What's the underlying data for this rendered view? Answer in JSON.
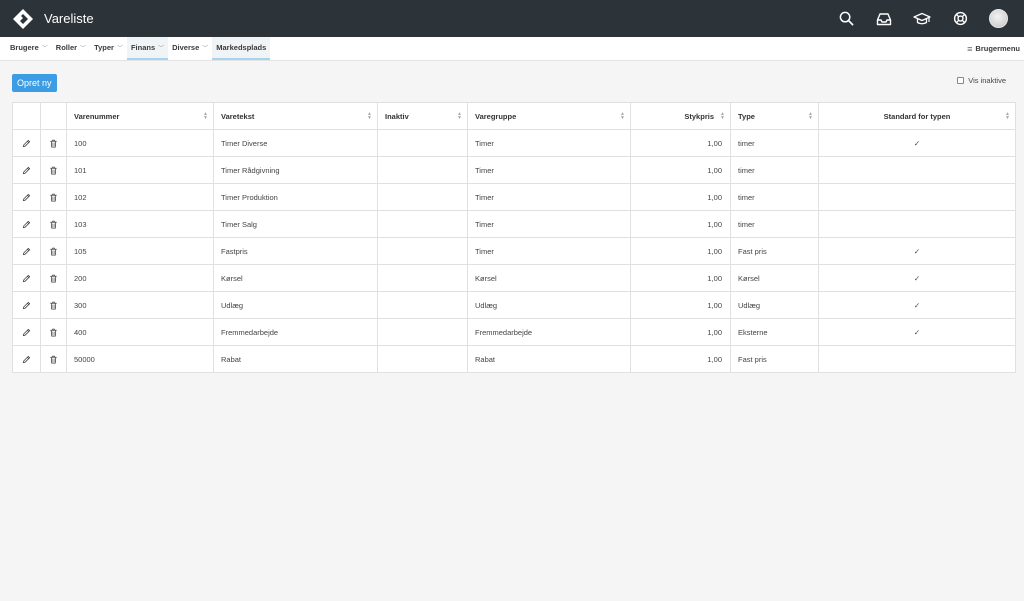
{
  "app": {
    "title": "Vareliste"
  },
  "topbar": {
    "icons": [
      "search-icon",
      "inbox-icon",
      "graduation-cap-icon",
      "lifebuoy-icon",
      "avatar"
    ]
  },
  "nav": {
    "items": [
      {
        "label": "Brugere",
        "dropdown": true
      },
      {
        "label": "Roller",
        "dropdown": true
      },
      {
        "label": "Typer",
        "dropdown": true
      },
      {
        "label": "Finans",
        "dropdown": true,
        "active": true
      },
      {
        "label": "Diverse",
        "dropdown": true
      },
      {
        "label": "Markedsplads",
        "dropdown": false,
        "active": true
      }
    ],
    "user_menu_label": "Brugermenu"
  },
  "toolbar": {
    "create_label": "Opret ny",
    "show_inactive_label": "Vis inaktive",
    "show_inactive_checked": false
  },
  "table": {
    "columns": [
      "Varenummer",
      "Varetekst",
      "Inaktiv",
      "Varegruppe",
      "Stykpris",
      "Type",
      "Standard for typen"
    ],
    "rows": [
      {
        "varenummer": "100",
        "varetekst": "Timer Diverse",
        "inaktiv": "",
        "varegruppe": "Timer",
        "stykpris": "1,00",
        "type": "timer",
        "standard": "✓"
      },
      {
        "varenummer": "101",
        "varetekst": "Timer Rådgivning",
        "inaktiv": "",
        "varegruppe": "Timer",
        "stykpris": "1,00",
        "type": "timer",
        "standard": ""
      },
      {
        "varenummer": "102",
        "varetekst": "Timer Produktion",
        "inaktiv": "",
        "varegruppe": "Timer",
        "stykpris": "1,00",
        "type": "timer",
        "standard": ""
      },
      {
        "varenummer": "103",
        "varetekst": "Timer Salg",
        "inaktiv": "",
        "varegruppe": "Timer",
        "stykpris": "1,00",
        "type": "timer",
        "standard": ""
      },
      {
        "varenummer": "105",
        "varetekst": "Fastpris",
        "inaktiv": "",
        "varegruppe": "Timer",
        "stykpris": "1,00",
        "type": "Fast pris",
        "standard": "✓"
      },
      {
        "varenummer": "200",
        "varetekst": "Kørsel",
        "inaktiv": "",
        "varegruppe": "Kørsel",
        "stykpris": "1,00",
        "type": "Kørsel",
        "standard": "✓"
      },
      {
        "varenummer": "300",
        "varetekst": "Udlæg",
        "inaktiv": "",
        "varegruppe": "Udlæg",
        "stykpris": "1,00",
        "type": "Udlæg",
        "standard": "✓"
      },
      {
        "varenummer": "400",
        "varetekst": "Fremmedarbejde",
        "inaktiv": "",
        "varegruppe": "Fremmedarbejde",
        "stykpris": "1,00",
        "type": "Eksterne",
        "standard": "✓"
      },
      {
        "varenummer": "50000",
        "varetekst": "Rabat",
        "inaktiv": "",
        "varegruppe": "Rabat",
        "stykpris": "1,00",
        "type": "Fast pris",
        "standard": ""
      }
    ]
  },
  "colors": {
    "topbar": "#2c3339",
    "accent": "#3d9de4",
    "active_tab_underline": "#a8d3ee"
  }
}
